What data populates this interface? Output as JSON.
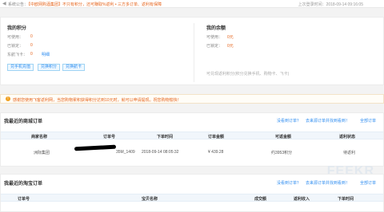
{
  "notice": {
    "icon": "speaker-icon",
    "label": "系统公告：",
    "text": "【中欧网购酒集团】不只有积分，还可赚取%返利 • 三方多订单、返利有保障",
    "last_login": "上次登录时间：2018-09-14 09:16:05"
  },
  "points": {
    "title": "我的积分",
    "available_label": "可使用：",
    "available_value": "0",
    "locked_label": "已锁定：",
    "locked_value": "0",
    "miles_label": "东航飞卡：",
    "miles_value": "0",
    "miles_link": "明细",
    "buttons": [
      "兑手机充值",
      "兑换积分",
      "兑换航卡"
    ]
  },
  "balance": {
    "title": "我的余额",
    "available_label": "可使用：",
    "available_value": "0元",
    "locked_label": "已锁定：",
    "locked_value": "0元",
    "hint": "可兑现返利积分(积分兑换手机、购物卡、飞卡)"
  },
  "tip": {
    "icon": "info-icon",
    "text": "感谢您使用飞客返利网，当您购物累积获得积分达到10元时，就可以申请提现。祝您购物愉快！"
  },
  "orders": {
    "title": "我最近的商城订单",
    "links": [
      "没看到订单？",
      "去来源订单并找到看到！",
      "全部订单"
    ],
    "headers": [
      "商家名称",
      "订单号",
      "下单时间",
      "订单金额",
      "可返金额",
      "返利状态"
    ],
    "rows": [
      {
        "merchant": "洲际集团",
        "order_no": "35M_1409",
        "time": "2018-09-14 08:05:32",
        "amount": "¥ 439.28",
        "rebate": "约3953积分",
        "status": "待返利"
      }
    ]
  },
  "taobao": {
    "title": "我最近的淘宝订单",
    "links": [
      "没看到订单？",
      "去来源订单并找到看到！",
      "全部订单"
    ],
    "headers": [
      "订单号",
      "宝贝名称",
      "成交额",
      "返利收入",
      "下单时间"
    ]
  }
}
